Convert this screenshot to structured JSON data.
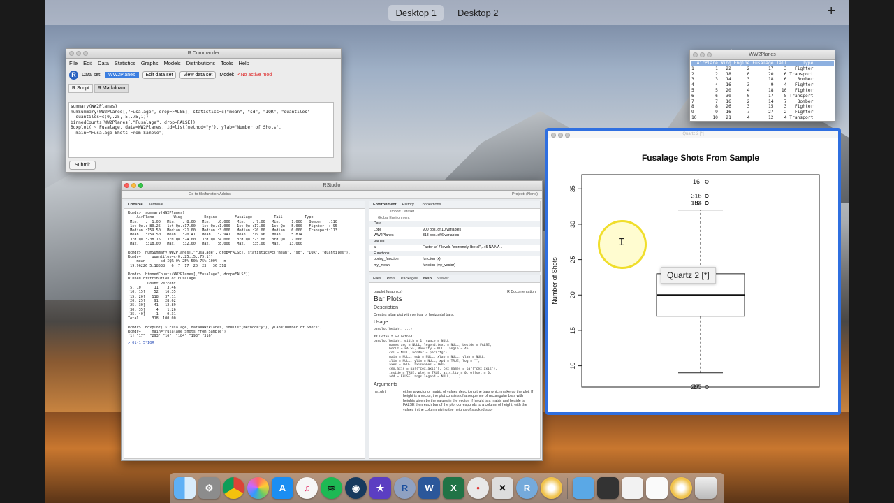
{
  "spaces": {
    "items": [
      "Desktop 1",
      "Desktop 2"
    ],
    "plus": "+"
  },
  "rcmdr": {
    "title": "R Commander",
    "menu": [
      "File",
      "Edit",
      "Data",
      "Statistics",
      "Graphs",
      "Models",
      "Distributions",
      "Tools",
      "Help"
    ],
    "dataset_label": "Data set:",
    "dataset_value": "WW2Planes",
    "edit_btn": "Edit data set",
    "view_btn": "View data set",
    "model_label": "Model:",
    "model_value": "<No active mod",
    "tabs": [
      "R Script",
      "R Markdown"
    ],
    "script": "summary(WW2Planes)\nnumSummary(WW2Planes[,\"Fusalage\", drop=FALSE], statistics=c(\"mean\", \"sd\", \"IQR\", \"quantiles\"\n  quantiles=c(0,.25,.5,.75,1))\nbinnedCounts(WW2Planes[,\"Fusalage\", drop=FALSE])\nBoxplot( ~ Fusalage, data=WW2Planes, id=list(method=\"y\"), ylab=\"Number of Shots\",\n  main=\"Fusalage Shots From Sample\")",
    "submit": "Submit"
  },
  "dataview": {
    "title": "WW2Planes",
    "header": "  AirPlane Wing Engine Fusalage Tail      Type",
    "rows": [
      "1        1   22      2       17    3   Fighter",
      "2        2   18      0       20    6 Transport",
      "3        3   14      3       18    6    Bomber",
      "4        4   16      3        9    4   Fighter",
      "5        5   20      4       18   10   Fighter",
      "6        6   30      0       17    8 Transport",
      "7        7   16      2       14    7    Bomber",
      "8        8   26      3       15    3   Fighter",
      "9        9   16      7       27    2   Fighter",
      "10      10   21      4       12    4 Transport"
    ]
  },
  "rstudio": {
    "title": "RStudio",
    "toolbar": "Go to file/function      Addins",
    "project": "Project: (None)",
    "console_tabs": [
      "Console",
      "Terminal"
    ],
    "console": "Rcmdr>  summary(WW2Planes)\n    AirPlane         Wing          Engine        Fusalage          Tail          Type    \n Min.   :  1.00   Min.   : 8.00   Min.   :0.000   Min.   : 7.00   Min.   : 1.000   Bomber   :110  \n 1st Qu.: 80.25   1st Qu.:17.00   1st Qu.:1.000   1st Qu.:17.00   1st Qu.: 5.000   Fighter  : 95  \n Median :159.50   Median :21.00   Median :3.000   Median :20.00   Median : 6.000   Transport:113  \n Mean   :159.50   Mean   :20.41   Mean   :2.947   Mean   :19.96   Mean   : 5.874                  \n 3rd Qu.:238.75   3rd Qu.:24.00   3rd Qu.:4.000   3rd Qu.:23.00   3rd Qu.: 7.000                  \n Max.   :318.00   Max.   :32.00   Max.   :8.000   Max.   :35.00   Max.   :13.000                  \n\nRcmdr>  numSummary(WW2Planes[,\"Fusalage\", drop=FALSE], statistics=c(\"mean\", \"sd\", \"IQR\", \"quantiles\"),\nRcmdr+     quantiles=c(0,.25,.5,.75,1))\n    mean       sd IQR 0% 25% 50% 75% 100%   n\n 19.96226 5.18538   6  7  17  20  23   36 318\n\nRcmdr>  binnedCounts(WW2Planes[,\"Fusalage\", drop=FALSE])\nBinned distribution of Fusalage\n         Count Percent\n[5, 10]     11    3.46\n(10, 15]    52   16.35\n(15, 20]   118   37.11\n(20, 25]    91   28.62\n(25, 30]    41   12.89\n(30, 35]     4    1.26\n(35, 40]     1    0.31\nTotal      318  100.00\n\nRcmdr>  Boxplot( ~ Fusalage, data=WW2Planes, id=list(method=\"y\"), ylab=\"Number of Shots\",\nRcmdr+     main=\"Fusalage Shots From Sample\")\n[1] \"17\"  \"293\" \"16\"  \"184\" \"193\" \"316\"",
    "console_prompt": "> Q1-1.5*IQR",
    "env_tabs": [
      "Environment",
      "History",
      "Connections"
    ],
    "env_toolbar": "Import Dataset",
    "env_scope": "Global Environment",
    "env_sections": {
      "data": "Data",
      "values": "Values",
      "functions": "Functions"
    },
    "env_data": [
      {
        "name": "Lobl",
        "desc": "900 obs. of 10 variables"
      },
      {
        "name": "WW2Planes",
        "desc": "318 obs. of 6 variables"
      }
    ],
    "env_values": [
      {
        "name": "a",
        "desc": "Factor w/ 7 levels \"extremely liberal\",..: 5 NA NA .."
      }
    ],
    "env_functions": [
      {
        "name": "boring_function",
        "desc": "function (x)"
      },
      {
        "name": "my_mean",
        "desc": "function (my_vector)"
      }
    ],
    "files_tabs": [
      "Files",
      "Plots",
      "Packages",
      "Help",
      "Viewer"
    ],
    "help_topic": "barplot {graphics}",
    "help_doc": "R Documentation",
    "help_title": "Bar Plots",
    "help_desc_h": "Description",
    "help_desc": "Creates a bar plot with vertical or horizontal bars.",
    "help_usage_h": "Usage",
    "help_usage": "barplot(height, ...)\n\n## Default S3 method:\nbarplot(height, width = 1, space = NULL,\n        names.arg = NULL, legend.text = NULL, beside = FALSE,\n        horiz = FALSE, density = NULL, angle = 45,\n        col = NULL, border = par(\"fg\"),\n        main = NULL, sub = NULL, xlab = NULL, ylab = NULL,\n        xlim = NULL, ylim = NULL, xpd = TRUE, log = \"\",\n        axes = TRUE, axisnames = TRUE,\n        cex.axis = par(\"cex.axis\"), cex.names = par(\"cex.axis\"),\n        inside = TRUE, plot = TRUE, axis.lty = 0, offset = 0,\n        add = FALSE, args.legend = NULL, ...)",
    "help_args_h": "Arguments",
    "help_arg_name": "height",
    "help_arg_desc": "either a vector or matrix of values describing the bars which make up the plot. If height is a vector, the plot consists of a sequence of rectangular bars with heights given by the values in the vector. If height is a matrix and beside is FALSE then each bar of the plot corresponds to a column of height, with the values in the column giving the heights of stacked sub-"
  },
  "quartz": {
    "title": "Quartz 2 [*]",
    "tooltip": "Quartz 2 [*]"
  },
  "chart_data": {
    "type": "box",
    "title": "Fusalage Shots From Sample",
    "ylabel": "Number of Shots",
    "ylim": [
      7,
      37
    ],
    "yticks": [
      10,
      15,
      20,
      25,
      30,
      35
    ],
    "box": {
      "lower_whisker": 9,
      "q1": 17,
      "median": 20,
      "q3": 23,
      "upper_whisker": 32
    },
    "outliers": [
      {
        "y": 36,
        "label": "16"
      },
      {
        "y": 34,
        "label": "316"
      },
      {
        "y": 33,
        "label": "193"
      },
      {
        "y": 33,
        "label": "184"
      },
      {
        "y": 7,
        "label": "293"
      },
      {
        "y": 7,
        "label": "17"
      }
    ]
  },
  "dock": {
    "items": [
      "finder-icon",
      "system-preferences-icon",
      "chrome-icon",
      "photos-icon",
      "app-store-icon",
      "itunes-icon",
      "spotify-icon",
      "steam-icon",
      "imovie-icon",
      "r-icon",
      "word-icon",
      "excel-icon",
      "messages-icon",
      "x11-icon",
      "rstudio-icon",
      "siri-icon",
      "folder-icon",
      "screenshots-icon",
      "document-icon",
      "preview-icon",
      "siri-2-icon",
      "trash-icon"
    ]
  }
}
